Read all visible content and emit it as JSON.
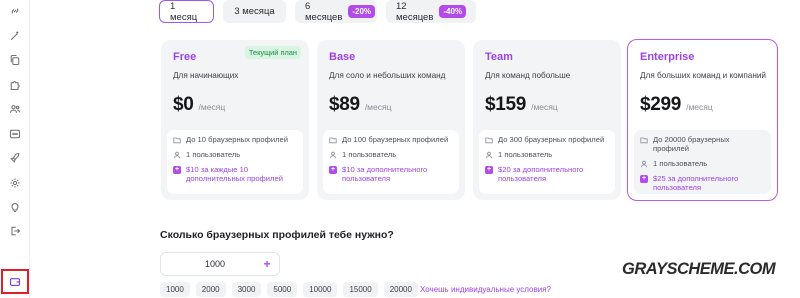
{
  "tabs": [
    {
      "label": "1 месяц",
      "active": true,
      "discount": ""
    },
    {
      "label": "3 месяца",
      "active": false,
      "discount": ""
    },
    {
      "label": "6 месяцев",
      "active": false,
      "discount": "-20%"
    },
    {
      "label": "12 месяцев",
      "active": false,
      "discount": "-40%"
    }
  ],
  "plans": [
    {
      "name": "Free",
      "badge": "Текущий план",
      "description": "Для начинающих",
      "price": "$0",
      "period": "/месяц",
      "profiles": "До 10 браузерных профилей",
      "users": "1 пользователь",
      "addon": "$10 за каждые 10 дополнительных профилей"
    },
    {
      "name": "Base",
      "badge": "",
      "description": "Для соло и небольших команд",
      "price": "$89",
      "period": "/месяц",
      "profiles": "До 100 браузерных профилей",
      "users": "1 пользователь",
      "addon": "$10 за дополнительного пользователя"
    },
    {
      "name": "Team",
      "badge": "",
      "description": "Для команд побольше",
      "price": "$159",
      "period": "/месяц",
      "profiles": "До 300 браузерных профилей",
      "users": "1 пользователь",
      "addon": "$20 за дополнительного пользователя"
    },
    {
      "name": "Enterprise",
      "badge": "",
      "description": "Для больших команд и компаний",
      "price": "$299",
      "period": "/месяц",
      "profiles": "До 20000 браузерных профилей",
      "users": "1 пользователь",
      "addon": "$25 за дополнительного пользователя"
    }
  ],
  "profiles_section": {
    "title": "Сколько браузерных профилей тебе нужно?",
    "value": "1000",
    "plus": "+",
    "presets": [
      "1000",
      "2000",
      "3000",
      "5000",
      "10000",
      "15000",
      "20000"
    ],
    "custom_link": "Хочешь индивидуальные условия?"
  },
  "watermark": "GRAYSCHEME.COM",
  "colors": {
    "accent": "#9b44e6",
    "highlight_border": "#b55ce8",
    "current_badge_bg": "#d9f4e2",
    "current_badge_text": "#1b8a47",
    "sidebar_marker": "#e11d2a"
  },
  "sidebar_icons": [
    "link-icon",
    "wand-icon",
    "copy-icon",
    "puzzle-icon",
    "users-icon",
    "api-icon",
    "rocket-icon",
    "settings-icon",
    "bulb-icon",
    "logout-icon",
    "wallet-icon"
  ]
}
